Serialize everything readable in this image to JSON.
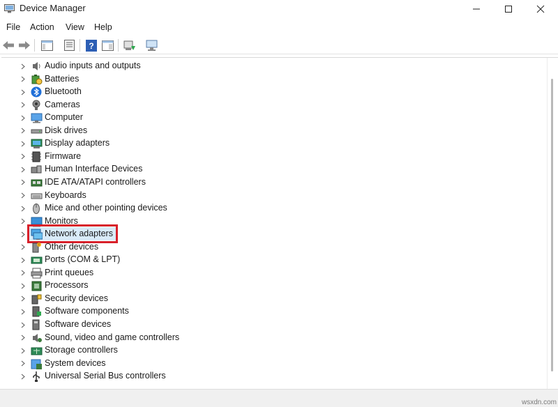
{
  "window": {
    "title": "Device Manager"
  },
  "menu": [
    {
      "label": "File"
    },
    {
      "label": "Action"
    },
    {
      "label": "View"
    },
    {
      "label": "Help"
    }
  ],
  "toolbar_icons": [
    "back-arrow-icon",
    "forward-arrow-icon",
    "properties-icon",
    "show-hide-tree-icon",
    "help-icon",
    "action-pane-icon",
    "update-driver-icon",
    "scan-hardware-icon"
  ],
  "tree": {
    "selected": "Network adapters",
    "items": [
      {
        "label": "Audio inputs and outputs",
        "icon": "speaker-icon"
      },
      {
        "label": "Batteries",
        "icon": "battery-icon"
      },
      {
        "label": "Bluetooth",
        "icon": "bluetooth-icon"
      },
      {
        "label": "Cameras",
        "icon": "camera-icon"
      },
      {
        "label": "Computer",
        "icon": "computer-icon"
      },
      {
        "label": "Disk drives",
        "icon": "disk-drive-icon"
      },
      {
        "label": "Display adapters",
        "icon": "display-adapter-icon"
      },
      {
        "label": "Firmware",
        "icon": "firmware-icon"
      },
      {
        "label": "Human Interface Devices",
        "icon": "hid-icon"
      },
      {
        "label": "IDE ATA/ATAPI controllers",
        "icon": "ide-controller-icon"
      },
      {
        "label": "Keyboards",
        "icon": "keyboard-icon"
      },
      {
        "label": "Mice and other pointing devices",
        "icon": "mouse-icon"
      },
      {
        "label": "Monitors",
        "icon": "monitor-icon"
      },
      {
        "label": "Network adapters",
        "icon": "network-adapter-icon"
      },
      {
        "label": "Other devices",
        "icon": "other-device-icon"
      },
      {
        "label": "Ports (COM & LPT)",
        "icon": "port-icon"
      },
      {
        "label": "Print queues",
        "icon": "printer-icon"
      },
      {
        "label": "Processors",
        "icon": "processor-icon"
      },
      {
        "label": "Security devices",
        "icon": "security-device-icon"
      },
      {
        "label": "Software components",
        "icon": "software-component-icon"
      },
      {
        "label": "Software devices",
        "icon": "software-device-icon"
      },
      {
        "label": "Sound, video and game controllers",
        "icon": "sound-controller-icon"
      },
      {
        "label": "Storage controllers",
        "icon": "storage-controller-icon"
      },
      {
        "label": "System devices",
        "icon": "system-device-icon"
      },
      {
        "label": "Universal Serial Bus controllers",
        "icon": "usb-icon"
      }
    ]
  },
  "watermark": "wsxdn.com",
  "colors": {
    "highlight_border": "#d8202a",
    "selection": "#d9ebf9",
    "icon_blue": "#2b7fd8"
  }
}
